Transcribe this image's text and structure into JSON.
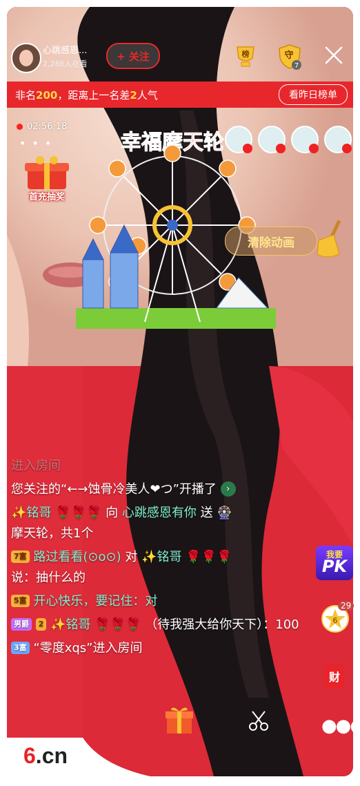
{
  "header": {
    "anchor_name": "心跳感恩...",
    "viewers": "2,286人在看",
    "follow_label": "+ 关注",
    "rank_icon_text": "榜",
    "guard_icon_text": "守",
    "guard_level": "7"
  },
  "rank_bar": {
    "prefix": "非名",
    "rank": "200",
    "middle": "，距离上一名差",
    "gap": "2",
    "suffix": "人气",
    "yesterday_button": "看昨日榜单"
  },
  "live": {
    "timer": "02:56:18",
    "lottery_label": "首充抽奖"
  },
  "animation": {
    "title": "幸福摩天轮",
    "clear_button": "清除动画"
  },
  "chat": [
    {
      "ghost": "进入房间"
    },
    {
      "text": "您关注的“←→蚀骨冷美人❤つ”开播了"
    },
    {
      "user": "✨铭哥",
      "verb": "向",
      "target": "心跳感恩有你",
      "action": "送",
      "gift": "摩天轮，共1个"
    },
    {
      "badge": "7富",
      "user": "路过看看(⊙o⊙)",
      "verb": "对",
      "target": "✨铭哥",
      "message": "说：抽什么的"
    },
    {
      "badge": "5富",
      "user": "开心快乐，要记住：对"
    },
    {
      "badge": "男爵",
      "level": "2",
      "user": "✨铭哥",
      "message": "（待我强大给你天下）：100"
    },
    {
      "badge": "3富",
      "message": "“零度xqs”进入房间"
    }
  ],
  "side": {
    "pk_top": "我要",
    "pk_bottom": "PK",
    "star_count": "29",
    "star_num": "6",
    "cai_label": "财"
  },
  "footer": {
    "logo_six": "6",
    "logo_cn": ".cn"
  }
}
